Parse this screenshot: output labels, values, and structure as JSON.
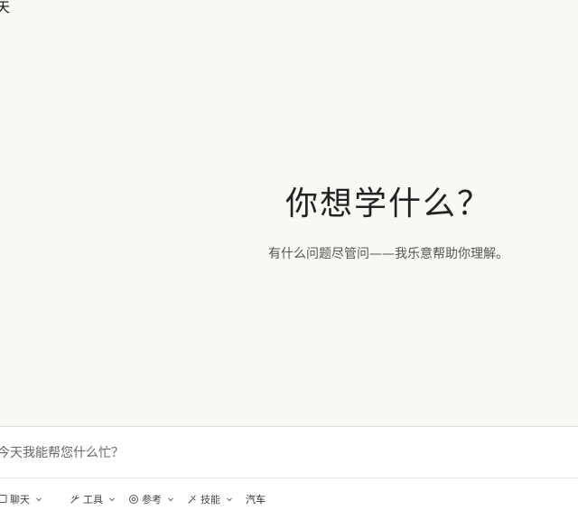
{
  "window": {
    "title_fragment": "天"
  },
  "hero": {
    "heading": "你想学什么？",
    "subheading": "有什么问题尽管问——我乐意帮助你理解。"
  },
  "composer": {
    "placeholder": "今天我能帮您什么忙？",
    "value": ""
  },
  "toolbar": {
    "mode_label": "聊天",
    "tools_label": "工具",
    "reference_label": "参考",
    "skills_label": "技能",
    "model_label": "汽车",
    "icons": {
      "mode": "chat-bubble-icon",
      "tools": "tools-icon",
      "reference": "at-sign-icon",
      "skills": "skills-icon",
      "chevron": "chevron-down-icon"
    }
  }
}
